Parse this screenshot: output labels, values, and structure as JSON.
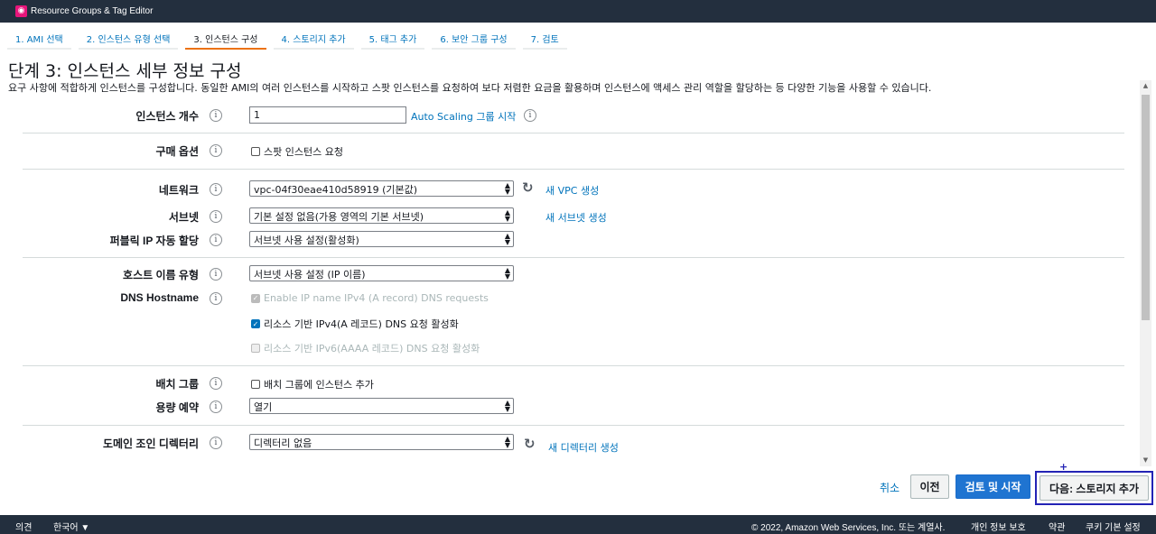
{
  "app": {
    "title": "Resource Groups & Tag Editor"
  },
  "steps": [
    "1. AMI 선택",
    "2. 인스턴스 유형 선택",
    "3. 인스턴스 구성",
    "4. 스토리지 추가",
    "5. 태그 추가",
    "6. 보안 그룹 구성",
    "7. 검토"
  ],
  "page": {
    "title": "단계 3: 인스턴스 세부 정보 구성",
    "description": "요구 사항에 적합하게 인스턴스를 구성합니다. 동일한 AMI의 여러 인스턴스를 시작하고 스팟 인스턴스를 요청하여 보다 저렴한 요금을 활용하며 인스턴스에 액세스 관리 역할을 할당하는 등 다양한 기능을 사용할 수 있습니다."
  },
  "form": {
    "instance_count": {
      "label": "인스턴스 개수",
      "value": "1",
      "link": "Auto Scaling 그룹 시작"
    },
    "purchase": {
      "label": "구매 옵션",
      "checkbox": "스팟 인스턴스 요청"
    },
    "network": {
      "label": "네트워크",
      "value": "vpc-04f30eae410d58919 (기본값)",
      "link": "새 VPC 생성"
    },
    "subnet": {
      "label": "서브넷",
      "value": "기본 설정 없음(가용 영역의 기본 서브넷)",
      "link": "새 서브넷 생성"
    },
    "public_ip": {
      "label": "퍼블릭 IP 자동 할당",
      "value": "서브넷 사용 설정(활성화)"
    },
    "hostname_type": {
      "label": "호스트 이름 유형",
      "value": "서브넷 사용 설정 (IP 이름)"
    },
    "dns_hostname": {
      "label": "DNS Hostname",
      "opt1": "Enable IP name IPv4 (A record) DNS requests",
      "opt2": "리소스 기반 IPv4(A 레코드) DNS 요청 활성화",
      "opt3": "리소스 기반 IPv6(AAAA 레코드) DNS 요청 활성화"
    },
    "placement": {
      "label": "배치 그룹",
      "checkbox": "배치 그룹에 인스턴스 추가"
    },
    "capacity": {
      "label": "용량 예약",
      "value": "열기"
    },
    "domain": {
      "label": "도메인 조인 디렉터리",
      "value": "디렉터리 없음",
      "link": "새 디렉터리 생성"
    }
  },
  "actions": {
    "cancel": "취소",
    "previous": "이전",
    "review": "검토 및 시작",
    "next": "다음: 스토리지 추가"
  },
  "footer": {
    "feedback": "의견",
    "language": "한국어 ▼",
    "copyright": "© 2022, Amazon Web Services, Inc. 또는 계열사.",
    "privacy": "개인 정보 보호",
    "terms": "약관",
    "cookies": "쿠키 기본 설정"
  },
  "icons": {
    "info": "info-icon",
    "refresh": "refresh-icon",
    "caret": "select-caret-icon"
  },
  "colors": {
    "link": "#0073bb",
    "primary": "#1f74d1",
    "nav": "#232f3e",
    "active_tab": "#ec7211"
  }
}
